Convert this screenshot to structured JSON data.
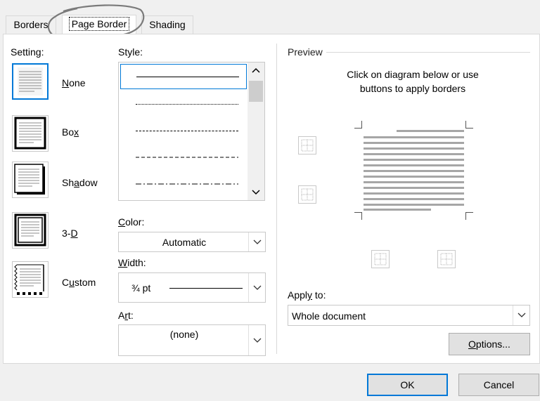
{
  "tabs": [
    {
      "label": "Borders"
    },
    {
      "label": "Page Border",
      "active": true
    },
    {
      "label": "Shading"
    }
  ],
  "setting": {
    "heading": "Setting:",
    "options": [
      {
        "label": "None",
        "selected": true
      },
      {
        "label": "Box"
      },
      {
        "label": "Shadow"
      },
      {
        "label": "3-D"
      },
      {
        "label": "Custom"
      }
    ]
  },
  "style": {
    "heading": "Style:",
    "options": [
      "solid",
      "dotted",
      "dash-small",
      "dashed",
      "dash-dot"
    ]
  },
  "color": {
    "heading": "Color:",
    "value": "Automatic"
  },
  "width": {
    "heading": "Width:",
    "value": "¾ pt"
  },
  "art": {
    "heading": "Art:",
    "value": "(none)"
  },
  "preview": {
    "heading": "Preview",
    "instruction": "Click on diagram below or use buttons to apply borders"
  },
  "apply_to": {
    "heading": "Apply to:",
    "value": "Whole document"
  },
  "buttons": {
    "options": "Options...",
    "ok": "OK",
    "cancel": "Cancel"
  },
  "colors": {
    "accent": "#0078d7",
    "annotation": "#7a7a7a"
  }
}
